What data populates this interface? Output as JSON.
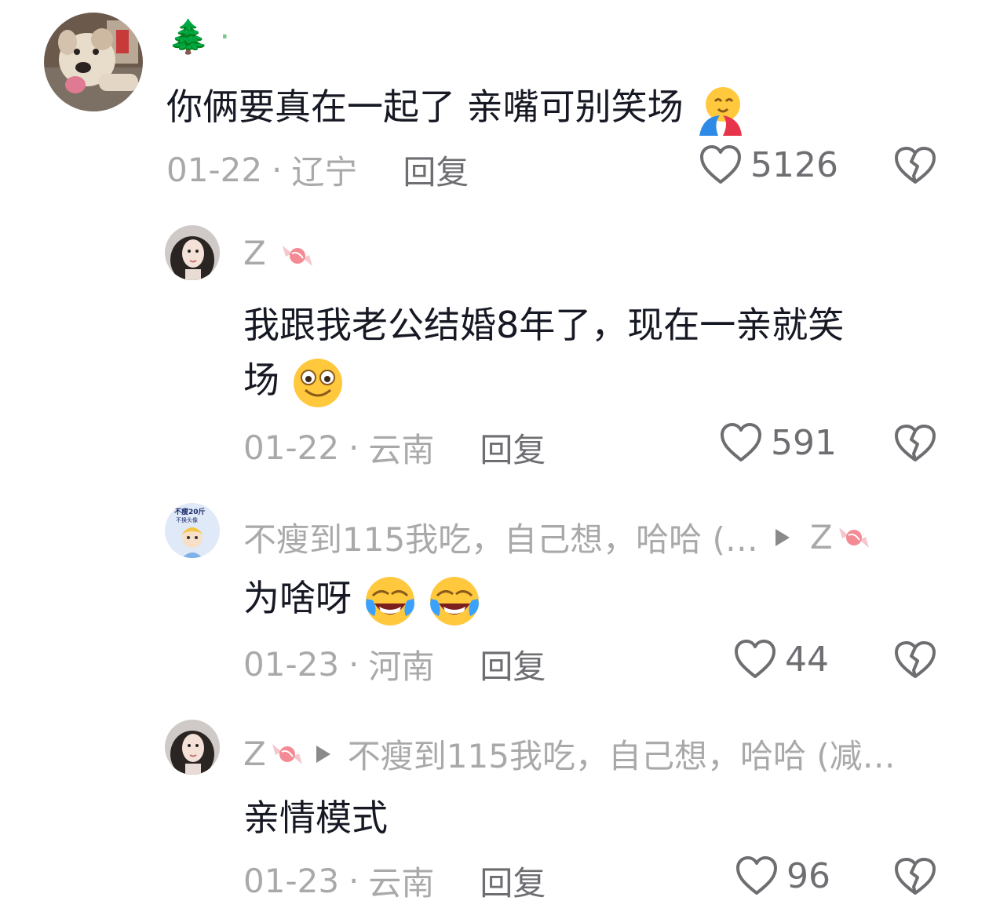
{
  "comments": [
    {
      "username": "🌲 ·",
      "text": "你俩要真在一起了 亲嘴可别笑场",
      "date": "01-22",
      "location": "辽宁",
      "reply_label": "回复",
      "likes": "5126",
      "avatar": "dog-avatar"
    },
    {
      "username": "Z",
      "text_line1": "我跟我老公结婚8年了，现在一亲就笑",
      "text_line2": "场",
      "date": "01-22",
      "location": "云南",
      "reply_label": "回复",
      "likes": "591",
      "avatar": "girl-avatar"
    },
    {
      "username": "不瘦到115我吃，自己想，哈哈 (…",
      "reply_to": "Z",
      "text": "为啥呀",
      "date": "01-23",
      "location": "河南",
      "reply_label": "回复",
      "likes": "44",
      "avatar": "cartoon-avatar",
      "avatar_text": "不瘦20斤 不换头像"
    },
    {
      "username": "Z",
      "reply_to": "不瘦到115我吃，自己想，哈哈 (减…",
      "text": "亲情模式",
      "date": "01-23",
      "location": "云南",
      "reply_label": "回复",
      "likes": "96",
      "avatar": "girl-avatar"
    }
  ],
  "dot": "·",
  "icons": {
    "like": "heart-outline-icon",
    "dislike": "broken-heart-icon",
    "reply_arrow": "play-triangle-icon",
    "candy": "candy-icon"
  },
  "colors": {
    "text": "#161823",
    "muted": "#a9a9a9",
    "action": "#6e6e72"
  }
}
